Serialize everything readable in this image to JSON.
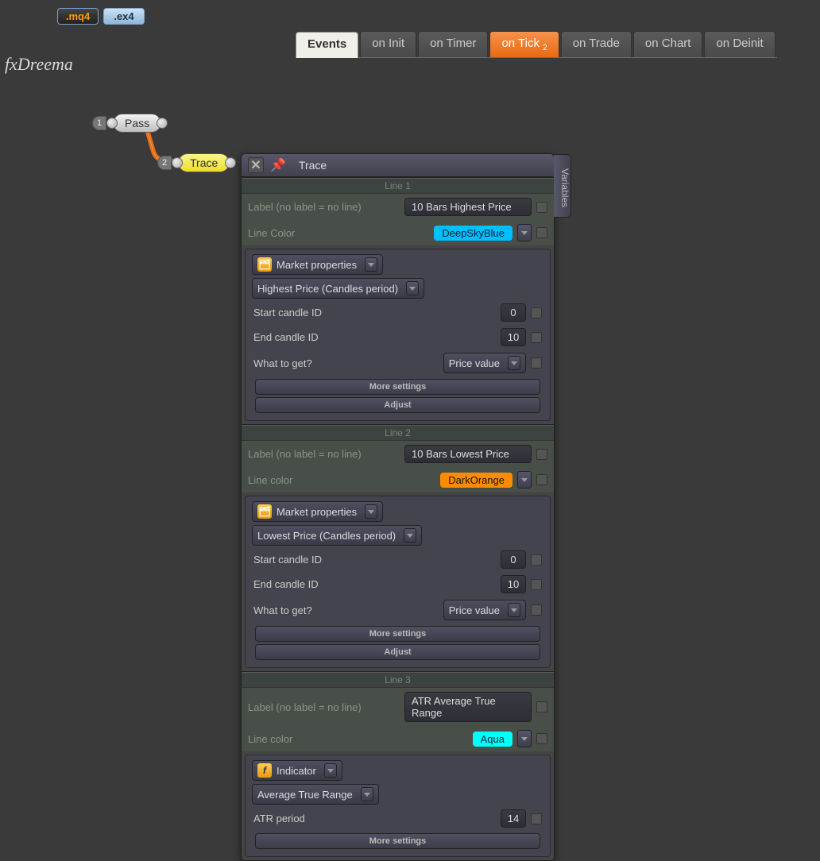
{
  "brand": "fxDreema",
  "file_buttons": {
    "mq4": ".mq4",
    "ex4": ".ex4"
  },
  "tabs": {
    "events": "Events",
    "on_init": "on Init",
    "on_timer": "on Timer",
    "on_tick": "on Tick",
    "on_tick_badge": "2",
    "on_trade": "on Trade",
    "on_chart": "on Chart",
    "on_deinit": "on Deinit"
  },
  "nodes": {
    "pass_num": "1",
    "pass_label": "Pass",
    "trace_num": "2",
    "trace_label": "Trace"
  },
  "panel": {
    "title": "Trace",
    "variables_tab": "Variables",
    "label_field": "Label (no label = no line)",
    "line_color_field_1": "Line Color",
    "line_color_field_2": "Line color",
    "more_settings": "More settings",
    "adjust": "Adjust",
    "start_candle": "Start candle ID",
    "end_candle": "End candle ID",
    "what_to_get": "What to get?",
    "market_properties": "Market properties",
    "indicator": "Indicator",
    "atr_period": "ATR period"
  },
  "line1": {
    "header": "Line 1",
    "label_value": "10 Bars Highest Price",
    "color_name": "DeepSkyBlue",
    "price_dropdown": "Highest Price (Candles period)",
    "start_candle": "0",
    "end_candle": "10",
    "what_to_get": "Price value"
  },
  "line2": {
    "header": "Line 2",
    "label_value": "10 Bars Lowest Price",
    "color_name": "DarkOrange",
    "price_dropdown": "Lowest Price (Candles period)",
    "start_candle": "0",
    "end_candle": "10",
    "what_to_get": "Price value"
  },
  "line3": {
    "header": "Line 3",
    "label_value": "ATR Average True Range",
    "color_name": "Aqua",
    "indicator_dropdown": "Average True Range",
    "atr_period": "14"
  }
}
